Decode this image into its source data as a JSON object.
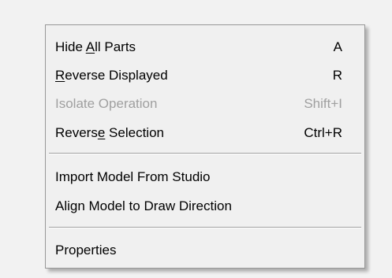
{
  "background_color": "#f2f2f2",
  "menu": {
    "background_color": "#f0f0f0",
    "border_color": "#979797",
    "disabled_text_color": "#a0a0a0",
    "items": [
      {
        "label_pre": "Hide ",
        "label_mnemonic": "A",
        "label_post": "ll Parts",
        "shortcut": "A",
        "enabled": true
      },
      {
        "label_pre": "",
        "label_mnemonic": "R",
        "label_post": "everse Displayed",
        "shortcut": "R",
        "enabled": true
      },
      {
        "label_pre": "Isolate Operation",
        "label_mnemonic": "",
        "label_post": "",
        "shortcut": "Shift+I",
        "enabled": false
      },
      {
        "label_pre": "Revers",
        "label_mnemonic": "e",
        "label_post": " Selection",
        "shortcut": "Ctrl+R",
        "enabled": true
      },
      {
        "label_pre": "Import Model From Studio",
        "label_mnemonic": "",
        "label_post": "",
        "shortcut": "",
        "enabled": true
      },
      {
        "label_pre": "Align Model to Draw Direction",
        "label_mnemonic": "",
        "label_post": "",
        "shortcut": "",
        "enabled": true
      },
      {
        "label_pre": "Properties",
        "label_mnemonic": "",
        "label_post": "",
        "shortcut": "",
        "enabled": true
      }
    ]
  }
}
